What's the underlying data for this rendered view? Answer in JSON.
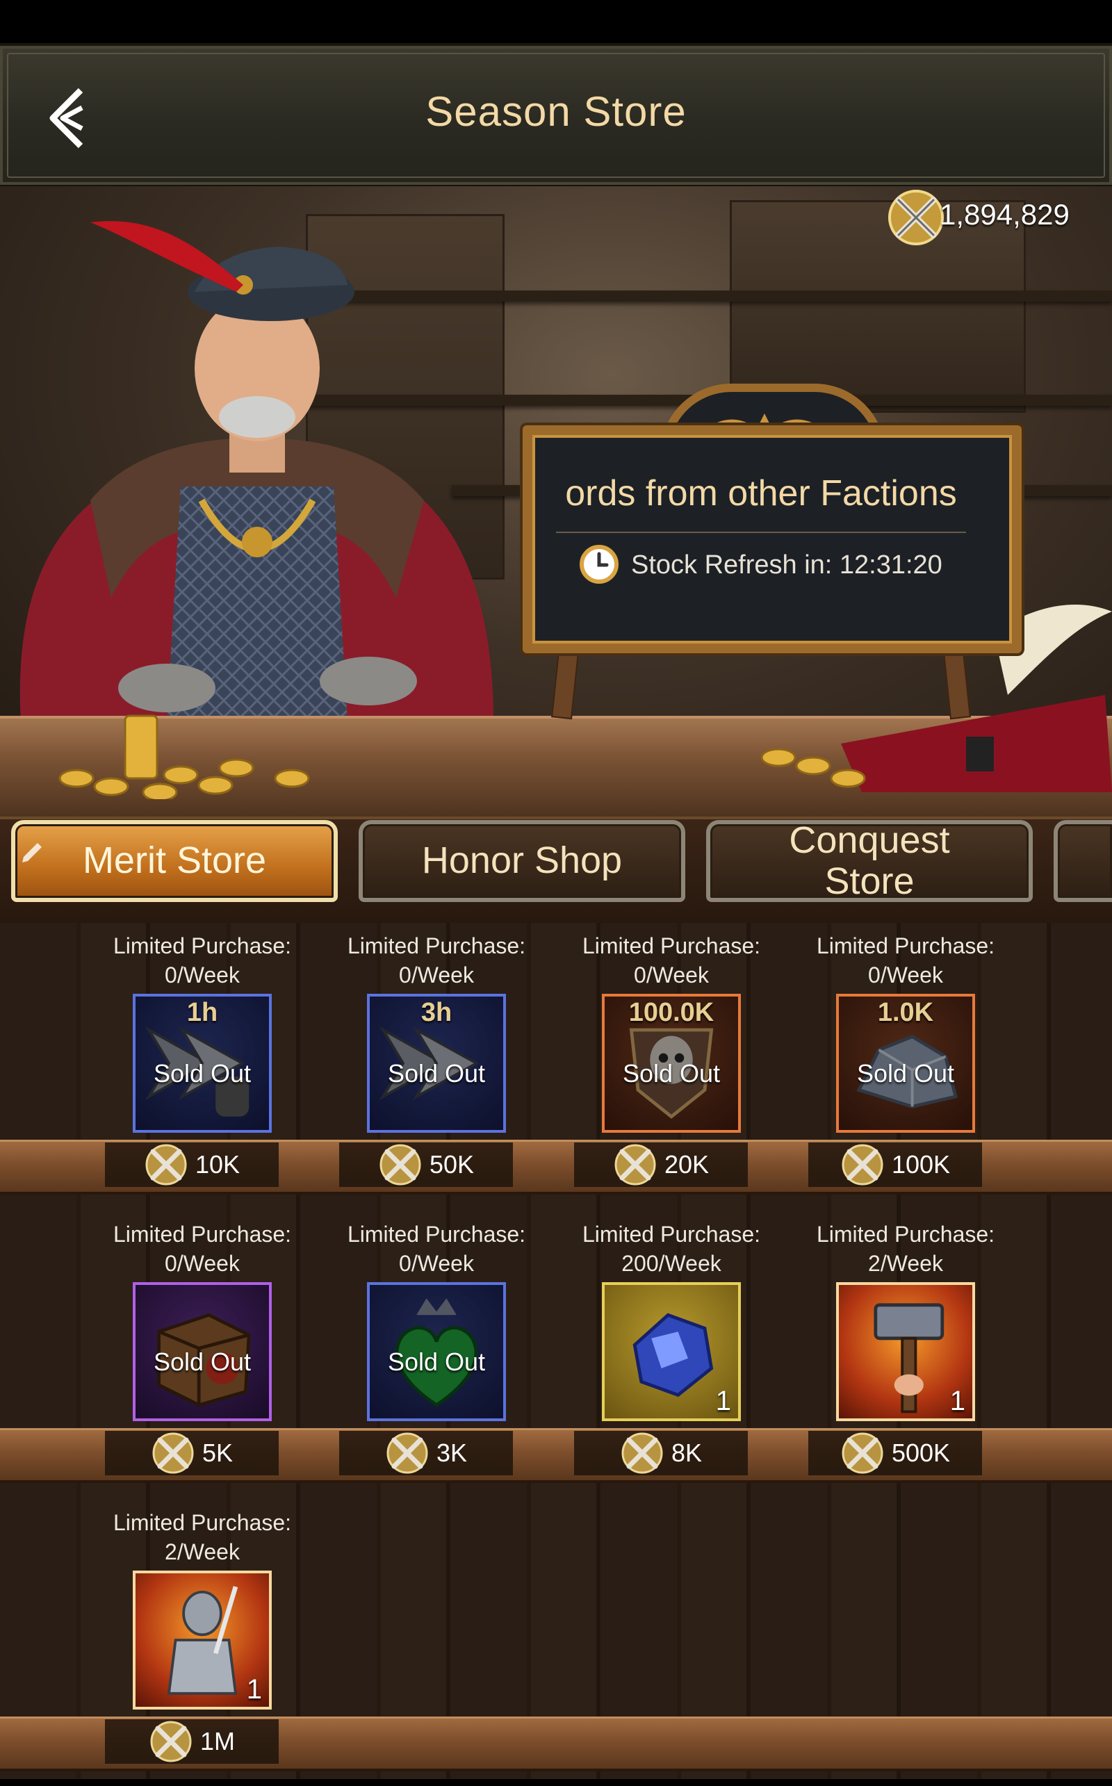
{
  "header": {
    "title": "Season Store"
  },
  "banner": {
    "currency_amount": "1,894,829",
    "sign_text": "ords from other Factions",
    "refresh_label": "Stock Refresh in: 12:31:20"
  },
  "tabs": [
    {
      "label": "Merit Store",
      "active": true
    },
    {
      "label": "Honor Shop",
      "active": false
    },
    {
      "label": "Conquest Store",
      "active": false
    }
  ],
  "items": [
    {
      "limit_line1": "Limited Purchase:",
      "limit_line2": "0/Week",
      "tag": "1h",
      "sold_out": "Sold Out",
      "price": "10K",
      "icon": "speedup-arrows-icon"
    },
    {
      "limit_line1": "Limited Purchase:",
      "limit_line2": "0/Week",
      "tag": "3h",
      "sold_out": "Sold Out",
      "price": "50K",
      "icon": "speedup-arrows-icon"
    },
    {
      "limit_line1": "Limited Purchase:",
      "limit_line2": "0/Week",
      "tag": "100.0K",
      "sold_out": "Sold Out",
      "price": "20K",
      "icon": "skull-shield-icon"
    },
    {
      "limit_line1": "Limited Purchase:",
      "limit_line2": "0/Week",
      "tag": "1.0K",
      "sold_out": "Sold Out",
      "price": "100K",
      "icon": "iron-ore-icon"
    },
    {
      "limit_line1": "Limited Purchase:",
      "limit_line2": "0/Week",
      "sold_out": "Sold Out",
      "price": "5K",
      "icon": "crate-icon"
    },
    {
      "limit_line1": "Limited Purchase:",
      "limit_line2": "0/Week",
      "sold_out": "Sold Out",
      "price": "3K",
      "icon": "green-heart-icon"
    },
    {
      "limit_line1": "Limited Purchase:",
      "limit_line2": "200/Week",
      "qty": "1",
      "price": "8K",
      "icon": "sapphire-ore-icon"
    },
    {
      "limit_line1": "Limited Purchase:",
      "limit_line2": "2/Week",
      "qty": "1",
      "price": "500K",
      "icon": "hammer-icon"
    },
    {
      "limit_line1": "Limited Purchase:",
      "limit_line2": "2/Week",
      "qty": "1",
      "price": "1M",
      "icon": "knight-icon"
    }
  ],
  "colors": {
    "accent": "#f3d9a6",
    "tab_active": "#c16f1c",
    "blue_frame": "#5b73e0",
    "orange_frame": "#e77a3a",
    "purple_frame": "#b060e8",
    "gold_frame": "#e6cf58"
  }
}
